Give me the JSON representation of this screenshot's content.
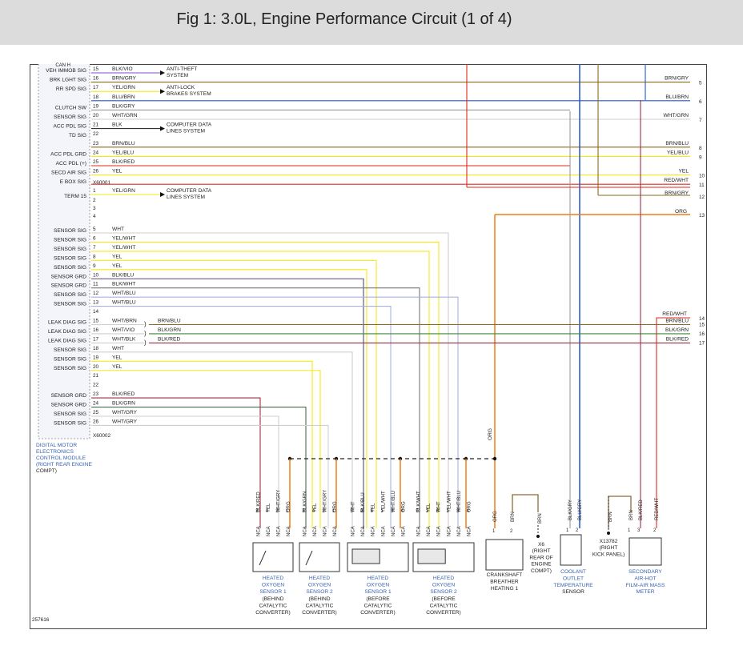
{
  "title": "Fig 1: 3.0L, Engine Performance Circuit (1 of 4)",
  "figure_number": "257616",
  "module": {
    "lines": [
      "DIGITAL MOTOR",
      "ELECTRONICS",
      "CONTROL MODULE",
      "(RIGHT REAR ENGINE",
      "COMPT)"
    ],
    "connector1": "X60001",
    "connector2": "X60002",
    "top_cut": "CAN H"
  },
  "pins_top": [
    {
      "label": "VEH IMMOB SIG",
      "pin": "15",
      "wire": "BLK/VIO",
      "dest": [
        "ANTI-THEFT",
        "SYSTEM"
      ]
    },
    {
      "label": "BRK LGHT SIG",
      "pin": "16",
      "wire": "BRN/GRY",
      "end": "BRN/GRY",
      "num": "5"
    },
    {
      "label": "RR SPD SIG",
      "pin": "17",
      "wire": "YEL/GRN",
      "dest": [
        "ANTI-LOCK",
        "BRAKES SYSTEM"
      ]
    },
    {
      "label": "",
      "pin": "18",
      "wire": "BLU/BRN",
      "end": "BLU/BRN",
      "num": "6"
    },
    {
      "label": "CLUTCH SW",
      "pin": "19",
      "wire": "BLK/GRY"
    },
    {
      "label": "SENSOR SIG",
      "pin": "20",
      "wire": "WHT/GRN",
      "end": "WHT/GRN",
      "num": "7"
    },
    {
      "label": "ACC PDL SIG",
      "pin": "21",
      "wire": "BLK",
      "dest": [
        "COMPUTER DATA",
        "LINES SYSTEM"
      ]
    },
    {
      "label": "TD SIG",
      "pin": "22",
      "wire": ""
    },
    {
      "label": "",
      "pin": "23",
      "wire": "BRN/BLU",
      "end": "BRN/BLU",
      "num": "8"
    },
    {
      "label": "ACC PDL GRD",
      "pin": "24",
      "wire": "YEL/BLU",
      "end": "YEL/BLU",
      "num": "9"
    },
    {
      "label": "ACC PDL (+)",
      "pin": "25",
      "wire": "BLK/RED"
    },
    {
      "label": "SECD AIR SIG",
      "pin": "26",
      "wire": "YEL",
      "end": "YEL",
      "num": "10"
    },
    {
      "label": "E BOX SIG",
      "pin": "",
      "wire": "",
      "end": "RED/WHT",
      "num": "11"
    }
  ],
  "term15": {
    "label": "TERM 15",
    "pin": "1",
    "wire": "YEL/GRN",
    "dest": [
      "COMPUTER DATA",
      "LINES SYSTEM"
    ],
    "end": "BRN/GRY",
    "num": "12"
  },
  "org13": {
    "wire": "ORG",
    "num": "13"
  },
  "pins_bottom": [
    {
      "label": "SENSOR SIG",
      "pin": "5",
      "wire": "WHT"
    },
    {
      "label": "SENSOR SIG",
      "pin": "6",
      "wire": "YEL/WHT"
    },
    {
      "label": "SENSOR SIG",
      "pin": "7",
      "wire": "YEL/WHT"
    },
    {
      "label": "SENSOR SIG",
      "pin": "8",
      "wire": "YEL"
    },
    {
      "label": "SENSOR SIG",
      "pin": "9",
      "wire": "YEL"
    },
    {
      "label": "SENSOR GRD",
      "pin": "10",
      "wire": "BLK/BLU"
    },
    {
      "label": "SENSOR GRD",
      "pin": "11",
      "wire": "BLK/WHT"
    },
    {
      "label": "SENSOR SIG",
      "pin": "12",
      "wire": "WHT/BLU"
    },
    {
      "label": "SENSOR SIG",
      "pin": "13",
      "wire": "WHT/BLU"
    },
    {
      "label": "",
      "pin": "14",
      "wire": ""
    },
    {
      "label": "LEAK DIAG SIG",
      "pin": "15",
      "wire": "WHT/BRN"
    },
    {
      "label": "LEAK DIAG SIG",
      "pin": "16",
      "wire": "WHT/VIO"
    },
    {
      "label": "LEAK DIAG SIG",
      "pin": "17",
      "wire": "WHT/BLK"
    },
    {
      "label": "SENSOR SIG",
      "pin": "18",
      "wire": "WHT"
    },
    {
      "label": "SENSOR SIG",
      "pin": "19",
      "wire": "YEL"
    },
    {
      "label": "SENSOR SIG",
      "pin": "20",
      "wire": "YEL"
    },
    {
      "label": "",
      "pin": "21",
      "wire": ""
    },
    {
      "label": "",
      "pin": "22",
      "wire": ""
    },
    {
      "label": "SENSOR GRD",
      "pin": "23",
      "wire": "BLK/RED"
    },
    {
      "label": "SENSOR GRD",
      "pin": "24",
      "wire": "BLK/GRN"
    },
    {
      "label": "SENSOR SIG",
      "pin": "25",
      "wire": "WHT/GRY"
    },
    {
      "label": "SENSOR SIG",
      "pin": "26",
      "wire": "WHT/GRY"
    }
  ],
  "leak_splices": [
    {
      "wire": "BRN/BLU"
    },
    {
      "wire": "BLK/GRN",
      "end": "BRN/BLU",
      "num": "15"
    },
    {
      "wire": "BLK/RED",
      "end": "BLK/GRN",
      "num": "16"
    },
    {
      "end": "BLK/RED",
      "num": "17"
    }
  ],
  "redwht14": {
    "wire": "RED/WHT",
    "num": "14"
  },
  "bottom_pin_labels": [
    "1",
    "2",
    "3",
    "4"
  ],
  "components": [
    {
      "name": [
        "HEATED",
        "OXYGEN",
        "SENSOR 1",
        "(BEHIND",
        "CATALYTIC",
        "CONVERTER)"
      ],
      "wires": [
        "NCA",
        "NCA",
        "NCA",
        "NCA"
      ],
      "wire_top": [
        "BLK/RED",
        "YEL",
        "WHT/GRY",
        "ORG"
      ],
      "pins": [
        "3",
        "4",
        "2",
        "1"
      ]
    },
    {
      "name": [
        "HEATED",
        "OXYGEN",
        "SENSOR 2",
        "(BEHIND",
        "CATALYTIC",
        "CONVERTER)"
      ],
      "wires": [
        "NCA",
        "NCA",
        "NCA",
        "NCA"
      ],
      "wire_top": [
        "BLK/GRN",
        "YEL",
        "WHT/GRY",
        "ORG"
      ],
      "pins": [
        "3",
        "4",
        "2",
        "1"
      ]
    },
    {
      "name": [
        "HEATED",
        "OXYGEN",
        "SENSOR 1",
        "(BEFORE",
        "CATALYTIC",
        "CONVERTER)"
      ],
      "wires": [
        "NCA",
        "NCA",
        "NCA",
        "NCA",
        "NCA",
        "NCA"
      ],
      "wire_top": [
        "WHT",
        "BLK/BLU",
        "YEL",
        "YEL/WHT",
        "WHT/BLU",
        "ORG"
      ],
      "pins": [
        "5",
        "2",
        "6",
        "1",
        "3",
        "4"
      ]
    },
    {
      "name": [
        "HEATED",
        "OXYGEN",
        "SENSOR 2",
        "(BEFORE",
        "CATALYTIC",
        "CONVERTER)"
      ],
      "wires": [
        "NCA",
        "NCA",
        "NCA",
        "NCA",
        "NCA",
        "NCA"
      ],
      "wire_top": [
        "BLK/WHT",
        "YEL",
        "WHT",
        "YEL/WHT",
        "WHT/BLU",
        "ORG"
      ],
      "pins": [
        "5",
        "2",
        "6",
        "1",
        "3",
        "4"
      ]
    },
    {
      "name": [
        "CRANKSHAFT",
        "BREATHER",
        "HEATING 1"
      ],
      "wire_top": [
        "ORG",
        "BRN"
      ],
      "pins": [
        "1",
        "2"
      ]
    },
    {
      "name": [
        "COOLANT",
        "OUTLET",
        "TEMPERATURE",
        "SENSOR"
      ],
      "wire_top": [
        "BLK/GRY",
        "BLU/GRY"
      ],
      "pins": [
        "1",
        "2"
      ]
    },
    {
      "name": [
        "SECONDARY",
        "AIR-HOT",
        "FILM-AIR MASS",
        "METER"
      ],
      "wire_top": [
        "BRN",
        "BLK/RED",
        "RED/WHT"
      ],
      "pins": [
        "1",
        "3",
        "2"
      ]
    }
  ],
  "grounds": [
    {
      "wire": "BRN",
      "name": [
        "X6",
        "(RIGHT",
        "REAR OF",
        "ENGINE",
        "COMPT)"
      ]
    },
    {
      "wire": "BRN",
      "name": [
        "X13782",
        "(RIGHT",
        "KICK PANEL)"
      ]
    }
  ],
  "org_vertical": "ORG",
  "colors": {
    "org": "#f07d16",
    "yel": "#f4ea1a",
    "red": "#e02a20",
    "blu": "#2456c8",
    "brn": "#8a6a3a",
    "grn": "#3a8a3a",
    "blk": "#333333",
    "wht": "#cfcfcf",
    "gry": "#9a9a9a",
    "vio": "#8a4ad0",
    "olive": "#8b6a20",
    "lblu": "#aab0e0",
    "accent": "#3a63b0"
  }
}
